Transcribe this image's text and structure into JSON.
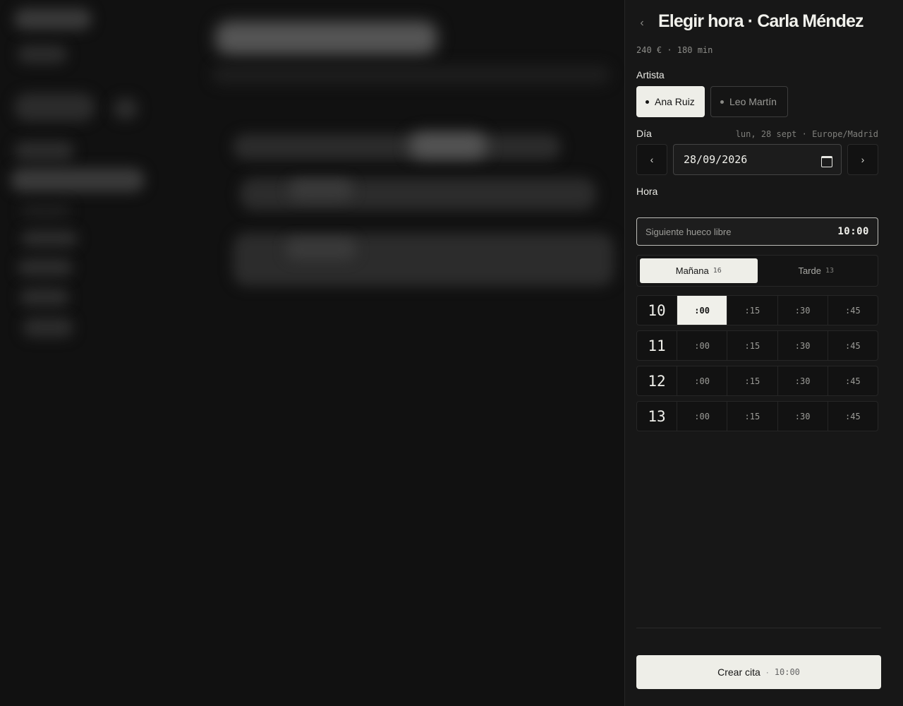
{
  "panel": {
    "title": "Elegir hora · Carla Méndez",
    "subtitle": "240 € · 180 min",
    "back_icon": "chevron-left-icon"
  },
  "artist": {
    "label": "Artista",
    "options": [
      {
        "name": "Ana Ruiz",
        "selected": true
      },
      {
        "name": "Leo Martín",
        "selected": false
      }
    ]
  },
  "day": {
    "label": "Día",
    "meta": "lun, 28 sept · Europe/Madrid",
    "value": "28/09/2026",
    "prev_icon": "chevron-left-icon",
    "next_icon": "chevron-right-icon"
  },
  "hour": {
    "label": "Hora",
    "next_free_label": "Siguiente hueco libre",
    "next_free_value": "10:00",
    "tabs": [
      {
        "label": "Mañana",
        "count": "16",
        "active": true
      },
      {
        "label": "Tarde",
        "count": "13",
        "active": false
      }
    ],
    "rows": [
      {
        "hour": "10",
        "slots": [
          ":00",
          ":15",
          ":30",
          ":45"
        ]
      },
      {
        "hour": "11",
        "slots": [
          ":00",
          ":15",
          ":30",
          ":45"
        ]
      },
      {
        "hour": "12",
        "slots": [
          ":00",
          ":15",
          ":30",
          ":45"
        ]
      },
      {
        "hour": "13",
        "slots": [
          ":00",
          ":15",
          ":30",
          ":45"
        ]
      }
    ],
    "selected": "10:00"
  },
  "footer": {
    "create_label": "Crear cita",
    "separator": "·",
    "create_time": "10:00"
  },
  "colors": {
    "background": "#111111",
    "panel": "#171717",
    "accent": "#eeeee8"
  }
}
